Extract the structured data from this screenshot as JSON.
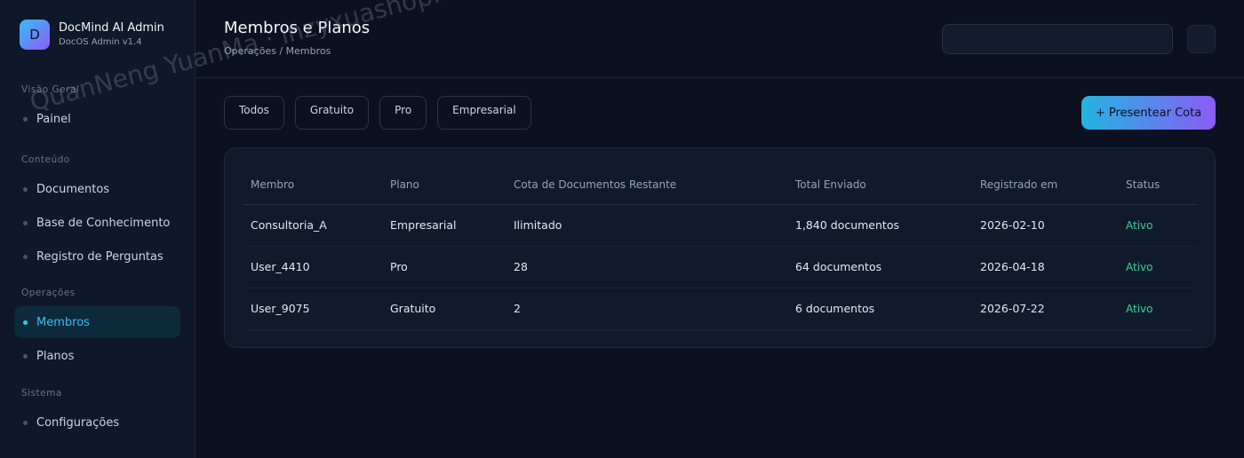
{
  "brand": {
    "logo_letter": "D",
    "title": "DocMind AI Admin",
    "subtitle": "DocOS Admin v1.4"
  },
  "sidebar": {
    "sections": [
      {
        "label": "Visão Geral",
        "items": [
          {
            "label": "Painel",
            "active": false
          }
        ]
      },
      {
        "label": "Conteúdo",
        "items": [
          {
            "label": "Documentos",
            "active": false
          },
          {
            "label": "Base de Conhecimento",
            "active": false
          },
          {
            "label": "Registro de Perguntas",
            "active": false
          }
        ]
      },
      {
        "label": "Operações",
        "items": [
          {
            "label": "Membros",
            "active": true
          },
          {
            "label": "Planos",
            "active": false
          }
        ]
      },
      {
        "label": "Sistema",
        "items": [
          {
            "label": "Configurações",
            "active": false
          }
        ]
      }
    ]
  },
  "header": {
    "title": "Membros e Planos",
    "breadcrumb": "Operações / Membros"
  },
  "filters": [
    "Todos",
    "Gratuito",
    "Pro",
    "Empresarial"
  ],
  "actions": {
    "gift_label": "+ Presentear Cota"
  },
  "table": {
    "columns": [
      "Membro",
      "Plano",
      "Cota de Documentos Restante",
      "Total Enviado",
      "Registrado em",
      "Status"
    ],
    "rows": [
      [
        "Consultoria_A",
        "Empresarial",
        "Ilimitado",
        "1,840 documentos",
        "2026-02-10",
        "Ativo"
      ],
      [
        "User_4410",
        "Pro",
        "28",
        "64 documentos",
        "2026-04-18",
        "Ativo"
      ],
      [
        "User_9075",
        "Gratuito",
        "2",
        "6 documentos",
        "2026-07-22",
        "Ativo"
      ]
    ]
  },
  "watermark": "QuanNeng YuanMa · inzyxuashop.com",
  "colors": {
    "accent": "#38bdf8",
    "status_active": "#34d399",
    "background": "#0b1120"
  }
}
